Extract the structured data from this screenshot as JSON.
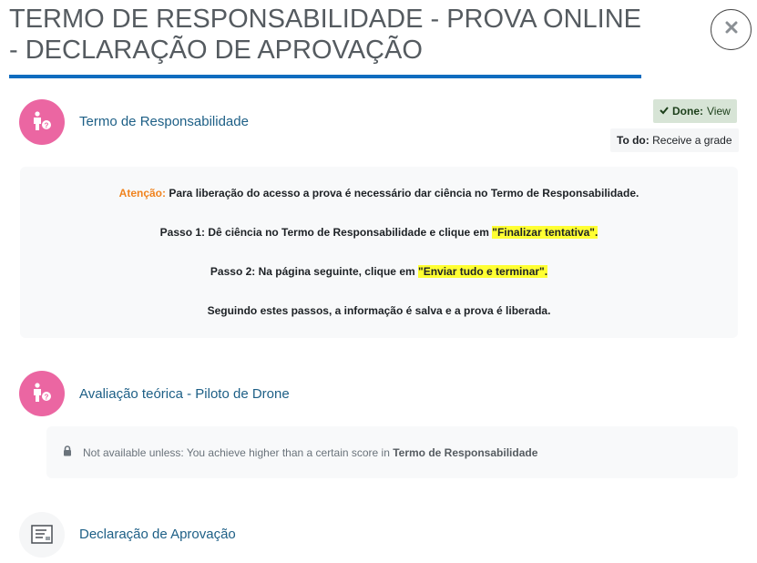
{
  "modal": {
    "title": "TERMO DE RESPONSABILIDADE - PROVA ONLINE - DECLARAÇÃO DE APROVAÇÃO",
    "close_icon": "close-icon"
  },
  "activities": [
    {
      "name": "Termo de Responsabilidade",
      "icon": "person-question-icon",
      "completion": {
        "done_label": "Done:",
        "done_value": "View",
        "todo_label": "To do:",
        "todo_value": "Receive a grade"
      },
      "description": {
        "line1_prefix": "Atenção:",
        "line1_text": " Para liberação do acesso a prova é necessário dar ciência no Termo de Responsabilidade.",
        "line2_text": "Passo 1: Dê ciência no Termo de Responsabilidade e clique em ",
        "line2_highlight": "\"Finalizar tentativa\".",
        "line3_text": "Passo 2: Na página seguinte, clique em ",
        "line3_highlight": "\"Enviar tudo e terminar\".",
        "line4_text": "Seguindo estes passos, a informação é salva e a prova é liberada."
      }
    },
    {
      "name": "Avaliação teórica - Piloto de Drone",
      "icon": "person-question-icon",
      "restriction": {
        "text": "Not available unless: You achieve higher than a certain score in ",
        "bold": "Termo de Responsabilidade"
      }
    },
    {
      "name": "Declaração de Aprovação",
      "icon": "certificate-icon"
    }
  ],
  "colors": {
    "accent": "#0f6cbf",
    "quiz_icon_bg": "#eb66a2",
    "link": "#1d5f86",
    "attention": "#f0831e",
    "highlight": "#ffff33",
    "done_bg": "#d7e4d6"
  }
}
